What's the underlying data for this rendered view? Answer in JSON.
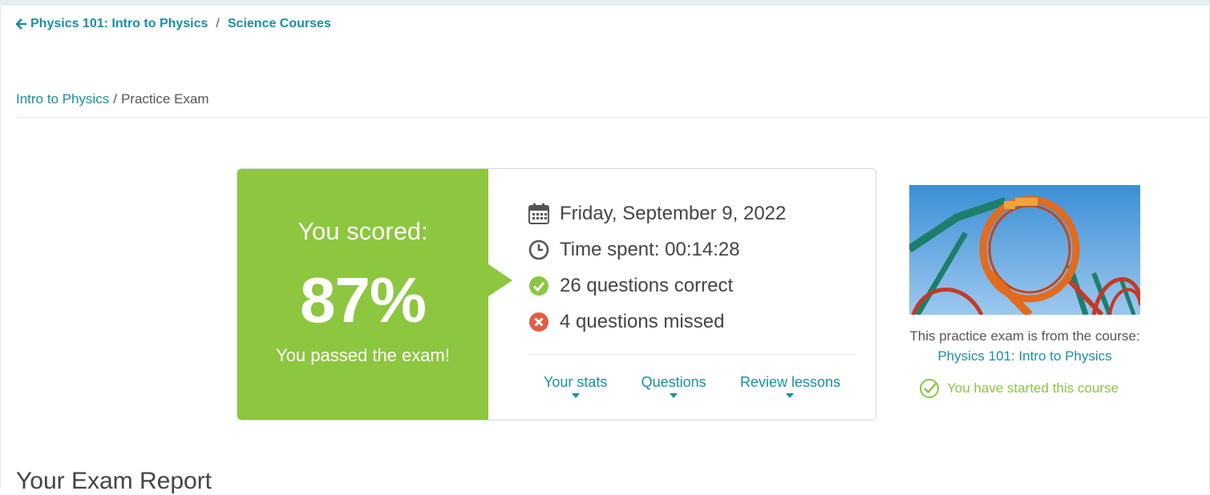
{
  "breadcrumb_top": {
    "course_link": "Physics 101: Intro to Physics",
    "separator": "/",
    "category_link": "Science Courses"
  },
  "breadcrumb_second": {
    "course_link": "Intro to Physics",
    "separator": "/",
    "current": "Practice Exam"
  },
  "score": {
    "label": "You scored:",
    "value": "87%",
    "message": "You passed the exam!"
  },
  "details": {
    "date": "Friday, September 9, 2022",
    "time_spent": "Time spent: 00:14:28",
    "correct": "26 questions correct",
    "missed": "4 questions missed"
  },
  "tabs": [
    {
      "label": "Your stats"
    },
    {
      "label": "Questions"
    },
    {
      "label": "Review lessons"
    }
  ],
  "course": {
    "from_text": "This practice exam is from the course:",
    "link": "Physics 101: Intro to Physics",
    "status": "You have started this course"
  },
  "report_heading": "Your Exam Report",
  "colors": {
    "accent": "#8dc63f",
    "link": "#1a8fa3",
    "error": "#e05d45"
  }
}
